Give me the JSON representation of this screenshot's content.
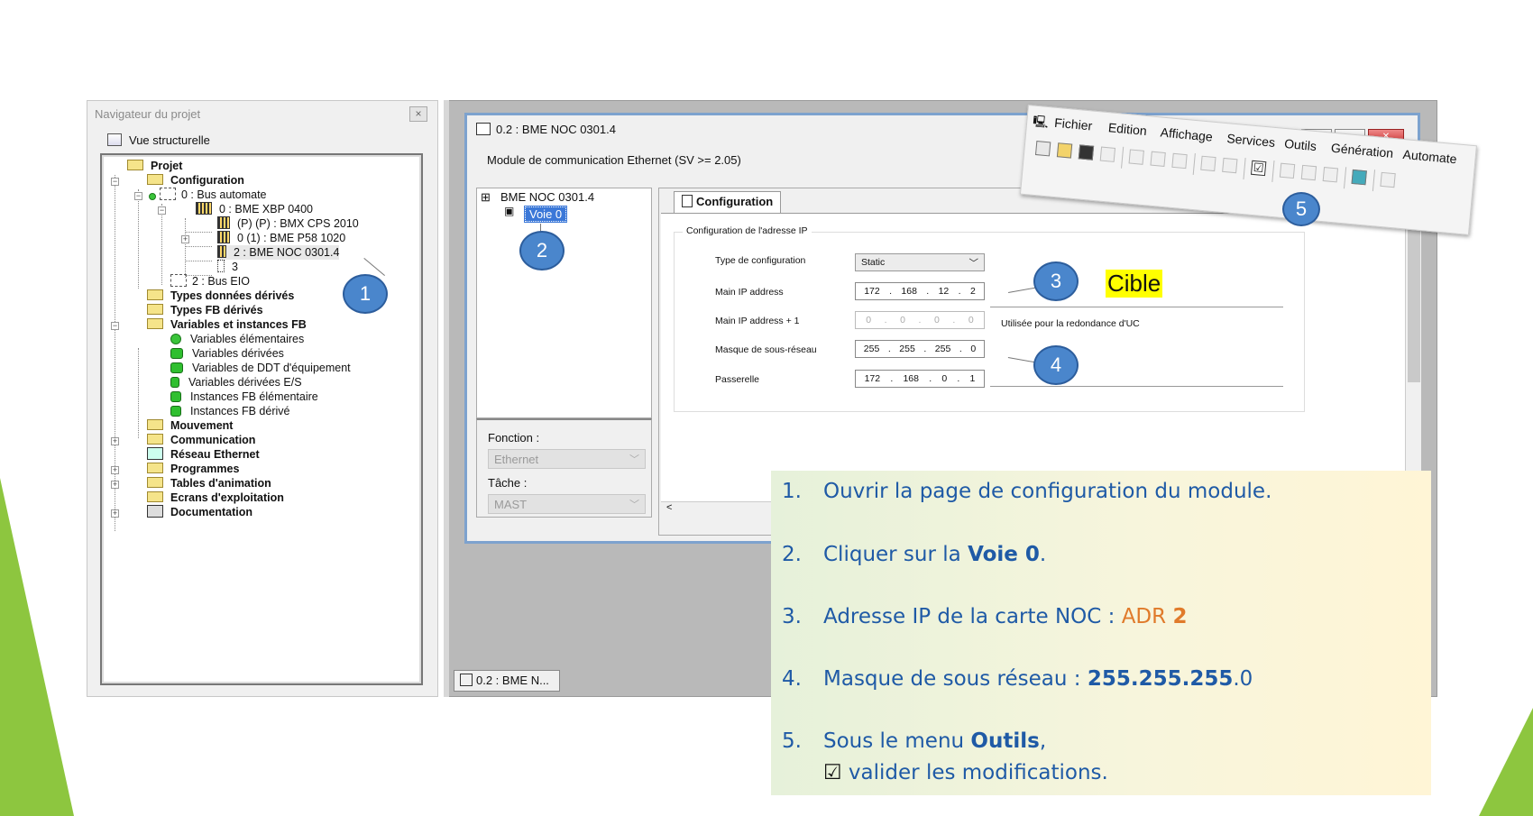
{
  "navigator": {
    "title": "Navigateur du projet",
    "close": "×",
    "view": "Vue structurelle",
    "tree": [
      "Projet",
      "Configuration",
      "0 : Bus automate",
      "0 : BME XBP 0400",
      "(P) (P) : BMX CPS 2010",
      "0 (1) : BME P58 1020",
      "2 : BME NOC 0301.4",
      "3",
      "2 : Bus EIO",
      "Types données dérivés",
      "Types FB dérivés",
      "Variables et instances FB",
      "Variables élémentaires",
      "Variables dérivées",
      "Variables de DDT d'équipement",
      "Variables dérivées E/S",
      "Instances FB élémentaire",
      "Instances FB dérivé",
      "Mouvement",
      "Communication",
      "Réseau Ethernet",
      "Programmes",
      "Tables d'animation",
      "Ecrans d'exploitation",
      "Documentation"
    ]
  },
  "window": {
    "title": "0.2 : BME NOC 0301.4",
    "subtitle": "Module de communication Ethernet (SV >= 2.05)",
    "module": "BME NOC 0301.4",
    "channel": "Voie 0",
    "function_label": "Fonction :",
    "function_value": "Ethernet",
    "task_label": "Tâche :",
    "task_value": "MAST",
    "tab": "Configuration",
    "scroll_left": "<",
    "btn_min": "—",
    "btn_max": "▭",
    "btn_close": "✕"
  },
  "ipconfig": {
    "group_title": "Configuration de l'adresse IP",
    "type_label": "Type de configuration",
    "type_value": "Static",
    "type_arrow": "﹀",
    "main_ip_label": "Main IP address",
    "main_ip": [
      "172",
      "168",
      "12",
      "2"
    ],
    "main_ip1_label": "Main IP address + 1",
    "main_ip1": [
      "0",
      "0",
      "0",
      "0"
    ],
    "redundancy_note": "Utilisée pour la redondance d'UC",
    "mask_label": "Masque de sous-réseau",
    "mask": [
      "255",
      "255",
      "255",
      "0"
    ],
    "gateway_label": "Passerelle",
    "gateway": [
      "172",
      "168",
      "0",
      "1"
    ],
    "sep": "."
  },
  "bottom_tab": "0.2 : BME N...",
  "menu": {
    "items": [
      "Fichier",
      "Edition",
      "Affichage",
      "Services",
      "Outils",
      "Génération",
      "Automate"
    ],
    "check": "☑"
  },
  "callouts": [
    "1",
    "2",
    "3",
    "4",
    "5"
  ],
  "target_label": "Cible",
  "instructions": {
    "s1": {
      "n": "1.",
      "text": "Ouvrir la page de configuration du module."
    },
    "s2": {
      "n": "2.",
      "a": "Cliquer sur la ",
      "b": "Voie 0",
      "c": "."
    },
    "s3": {
      "n": "3.",
      "a": "Adresse IP de la carte NOC : ",
      "b": "ADR ",
      "c": "2"
    },
    "s4": {
      "n": "4.",
      "a": "Masque de sous réseau : ",
      "b": "255.255.255",
      "c": ".0"
    },
    "s5": {
      "n": "5.",
      "a": "Sous le menu ",
      "b": "Outils",
      "c": ",",
      "check": "☑",
      "d": " valider les modifications."
    }
  },
  "colors": {
    "accent": "#1f5aa6",
    "orange": "#e07a2a",
    "callout": "#4a86cc",
    "green": "#8dc63f",
    "highlight": "#ffff00"
  }
}
